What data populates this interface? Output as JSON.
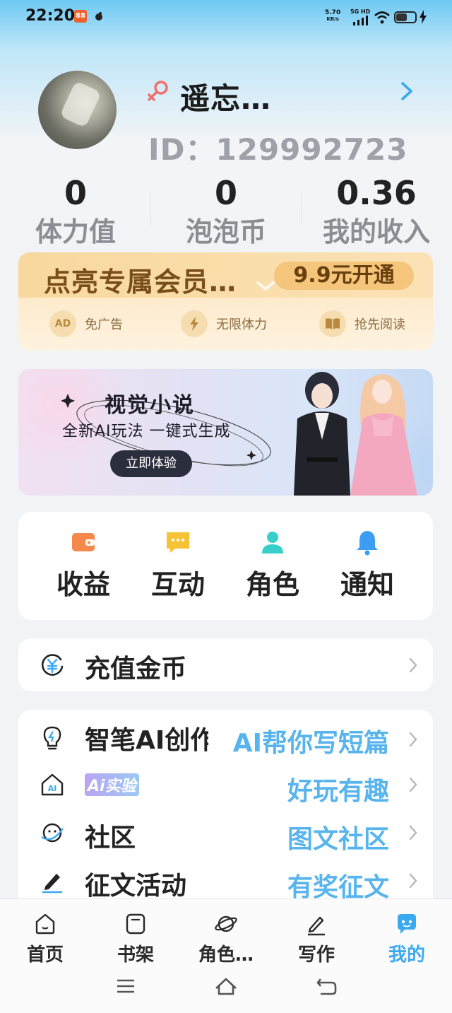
{
  "status_bar": {
    "time": "22:20",
    "net_speed_value": "5.70",
    "net_speed_unit": "KB/s",
    "network_type": "5G HD",
    "battery_level": 0.55
  },
  "profile": {
    "nickname": "遥忘…",
    "user_id": "ID：129992723"
  },
  "stats": [
    {
      "value": "0",
      "label": "体力值"
    },
    {
      "value": "0",
      "label": "泡泡币"
    },
    {
      "value": "0.36",
      "label": "我的收入"
    }
  ],
  "vip": {
    "title": "点亮专属会员…",
    "button": "9.9元开通",
    "features": [
      {
        "icon": "ad-icon",
        "icon_text": "AD",
        "label": "免广告"
      },
      {
        "icon": "lightning-icon",
        "icon_text": "",
        "label": "无限体力"
      },
      {
        "icon": "book-icon",
        "icon_text": "",
        "label": "抢先阅读"
      }
    ]
  },
  "banner": {
    "title": "视觉小说",
    "subtitle": "全新AI玩法 一键式生成",
    "button": "立即体验"
  },
  "quick_actions": [
    {
      "icon": "wallet-icon",
      "label": "收益",
      "color": "#f5894b"
    },
    {
      "icon": "chat-icon",
      "label": "互动",
      "color": "#f7c235"
    },
    {
      "icon": "person-icon",
      "label": "角色",
      "color": "#36cfc9"
    },
    {
      "icon": "bell-icon",
      "label": "通知",
      "color": "#3d9df2"
    }
  ],
  "recharge": {
    "icon": "yen-coin-icon",
    "label": "充值金币"
  },
  "menu": [
    {
      "icon": "lightbulb-icon",
      "label": "智笔AI创作",
      "desc": "AI帮你写短篇"
    },
    {
      "icon": "ai-home-icon",
      "label": "Ai实验",
      "desc": "好玩有趣"
    },
    {
      "icon": "planet-face-icon",
      "label": "社区",
      "desc": "图文社区"
    },
    {
      "icon": "pen-icon",
      "label": "征文活动",
      "desc": "有奖征文"
    }
  ],
  "bottom_nav": [
    {
      "icon": "home-icon",
      "label": "首页",
      "active": false
    },
    {
      "icon": "bookshelf-icon",
      "label": "书架",
      "active": false
    },
    {
      "icon": "planet-icon",
      "label": "角色…",
      "active": false
    },
    {
      "icon": "write-icon",
      "label": "写作",
      "active": false
    },
    {
      "icon": "mine-icon",
      "label": "我的",
      "active": true
    }
  ],
  "colors": {
    "accent": "#3ba9ef",
    "vip_text": "#7a4e1a",
    "desc_text": "#58b4ec"
  }
}
